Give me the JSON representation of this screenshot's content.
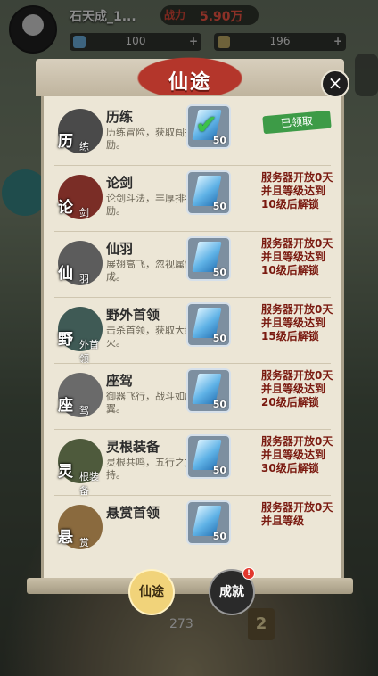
{
  "hud": {
    "player_name": "石天成_1...",
    "power_label": "战力",
    "power_value": "5.90万",
    "currency_gem": "100",
    "currency_coin": "196",
    "bottom_counter": "273",
    "bottom_badge": "2"
  },
  "dialog": {
    "title": "仙途",
    "close": "×",
    "tabs": [
      {
        "label": "仙途",
        "active": true
      },
      {
        "label": "成就",
        "active": false,
        "badge": "!"
      }
    ],
    "rows": [
      {
        "icon_char": "历",
        "icon_sub": "练",
        "name": "历练",
        "desc": "历练冒险，获取闯关奖励。",
        "reward_qty": "50",
        "status": "已领取"
      },
      {
        "icon_char": "论",
        "icon_sub": "剑",
        "name": "论剑",
        "desc": "论剑斗法，丰厚排名奖励。",
        "reward_qty": "50",
        "status": "服务器开放0天并且等级达到10级后解锁"
      },
      {
        "icon_char": "仙",
        "icon_sub": "羽",
        "name": "仙羽",
        "desc": "展翅高飞，忽视属性加成。",
        "reward_qty": "50",
        "status": "服务器开放0天并且等级达到10级后解锁"
      },
      {
        "icon_char": "野",
        "icon_sub": "外首领",
        "name": "野外首领",
        "desc": "击杀首领，获取大量异火。",
        "reward_qty": "50",
        "status": "服务器开放0天并且等级达到15级后解锁"
      },
      {
        "icon_char": "座",
        "icon_sub": "驾",
        "name": "座驾",
        "desc": "御器飞行，战斗如虎添翼。",
        "reward_qty": "50",
        "status": "服务器开放0天并且等级达到20级后解锁"
      },
      {
        "icon_char": "灵",
        "icon_sub": "根装备",
        "name": "灵根装备",
        "desc": "灵根共鸣，五行之力加持。",
        "reward_qty": "50",
        "status": "服务器开放0天并且等级达到30级后解锁"
      },
      {
        "icon_char": "悬",
        "icon_sub": "赏",
        "name": "悬赏首领",
        "desc": "",
        "reward_qty": "50",
        "status": "服务器开放0天并且等级"
      }
    ]
  }
}
